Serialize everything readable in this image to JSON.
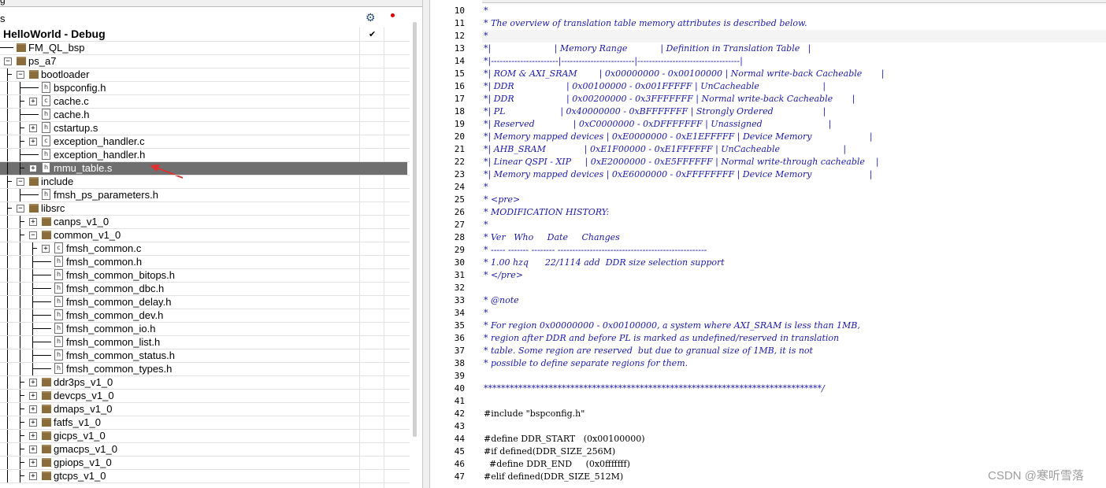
{
  "left_panel": {
    "top_fragment": "g",
    "header_title": "s",
    "tree": [
      {
        "label": "HelloWorld - Debug",
        "type": "project",
        "level": 0,
        "expander": "none"
      },
      {
        "label": "FM_QL_bsp",
        "type": "folder",
        "level": 1,
        "expander": "none"
      },
      {
        "label": "ps_a7",
        "type": "folder",
        "level": 1,
        "expander": "minus"
      },
      {
        "label": "bootloader",
        "type": "folder",
        "level": 2,
        "expander": "minus"
      },
      {
        "label": "bspconfig.h",
        "type": "file-h",
        "level": 3,
        "expander": "none"
      },
      {
        "label": "cache.c",
        "type": "file-c",
        "level": 3,
        "expander": "plus"
      },
      {
        "label": "cache.h",
        "type": "file-h",
        "level": 3,
        "expander": "none"
      },
      {
        "label": "cstartup.s",
        "type": "file-h",
        "level": 3,
        "expander": "plus"
      },
      {
        "label": "exception_handler.c",
        "type": "file-c",
        "level": 3,
        "expander": "plus"
      },
      {
        "label": "exception_handler.h",
        "type": "file-h",
        "level": 3,
        "expander": "none"
      },
      {
        "label": "mmu_table.s",
        "type": "file-h",
        "level": 3,
        "expander": "plus",
        "selected": true
      },
      {
        "label": "include",
        "type": "folder",
        "level": 2,
        "expander": "minus"
      },
      {
        "label": "fmsh_ps_parameters.h",
        "type": "file-h",
        "level": 3,
        "expander": "none"
      },
      {
        "label": "libsrc",
        "type": "folder",
        "level": 2,
        "expander": "minus"
      },
      {
        "label": "canps_v1_0",
        "type": "folder",
        "level": 3,
        "expander": "plus"
      },
      {
        "label": "common_v1_0",
        "type": "folder",
        "level": 3,
        "expander": "minus"
      },
      {
        "label": "fmsh_common.c",
        "type": "file-c",
        "level": 4,
        "expander": "plus"
      },
      {
        "label": "fmsh_common.h",
        "type": "file-h",
        "level": 4,
        "expander": "none"
      },
      {
        "label": "fmsh_common_bitops.h",
        "type": "file-h",
        "level": 4,
        "expander": "none"
      },
      {
        "label": "fmsh_common_dbc.h",
        "type": "file-h",
        "level": 4,
        "expander": "none"
      },
      {
        "label": "fmsh_common_delay.h",
        "type": "file-h",
        "level": 4,
        "expander": "none"
      },
      {
        "label": "fmsh_common_dev.h",
        "type": "file-h",
        "level": 4,
        "expander": "none"
      },
      {
        "label": "fmsh_common_io.h",
        "type": "file-h",
        "level": 4,
        "expander": "none"
      },
      {
        "label": "fmsh_common_list.h",
        "type": "file-h",
        "level": 4,
        "expander": "none"
      },
      {
        "label": "fmsh_common_status.h",
        "type": "file-h",
        "level": 4,
        "expander": "none"
      },
      {
        "label": "fmsh_common_types.h",
        "type": "file-h",
        "level": 4,
        "expander": "none"
      },
      {
        "label": "ddr3ps_v1_0",
        "type": "folder",
        "level": 3,
        "expander": "plus"
      },
      {
        "label": "devcps_v1_0",
        "type": "folder",
        "level": 3,
        "expander": "plus"
      },
      {
        "label": "dmaps_v1_0",
        "type": "folder",
        "level": 3,
        "expander": "plus"
      },
      {
        "label": "fatfs_v1_0",
        "type": "folder",
        "level": 3,
        "expander": "plus"
      },
      {
        "label": "gicps_v1_0",
        "type": "folder",
        "level": 3,
        "expander": "plus"
      },
      {
        "label": "gmacps_v1_0",
        "type": "folder",
        "level": 3,
        "expander": "plus"
      },
      {
        "label": "gpiops_v1_0",
        "type": "folder",
        "level": 3,
        "expander": "plus"
      },
      {
        "label": "gtcps_v1_0",
        "type": "folder",
        "level": 3,
        "expander": "plus"
      }
    ]
  },
  "editor": {
    "lines": [
      {
        "n": "10",
        "t": "*",
        "k": "c"
      },
      {
        "n": "11",
        "t": "* The overview of translation table memory attributes is described below.",
        "k": "c"
      },
      {
        "n": "12",
        "t": "*",
        "k": "c"
      },
      {
        "n": "13",
        "t": "*|                       | Memory Range            | Definition in Translation Table   |",
        "k": "c"
      },
      {
        "n": "14",
        "t": "*|-----------------------|-------------------------|-----------------------------------|",
        "k": "c"
      },
      {
        "n": "15",
        "t": "*| ROM & AXI_SRAM        | 0x00000000 - 0x00100000 | Normal write-back Cacheable       |",
        "k": "c"
      },
      {
        "n": "16",
        "t": "*| DDR                   | 0x00100000 - 0x001FFFFF | UnCacheable                       |",
        "k": "c"
      },
      {
        "n": "17",
        "t": "*| DDR                   | 0x00200000 - 0x3FFFFFFF | Normal write-back Cacheable       |",
        "k": "c"
      },
      {
        "n": "18",
        "t": "*| PL                    | 0x40000000 - 0xBFFFFFFF | Strongly Ordered                  |",
        "k": "c"
      },
      {
        "n": "19",
        "t": "*| Reserved              | 0xC0000000 - 0xDFFFFFFF | Unassigned                        |",
        "k": "c"
      },
      {
        "n": "20",
        "t": "*| Memory mapped devices | 0xE0000000 - 0xE1EFFFFF | Device Memory                     |",
        "k": "c"
      },
      {
        "n": "21",
        "t": "*| AHB_SRAM              | 0xE1F00000 - 0xE1FFFFFF | UnCacheable                       |",
        "k": "c"
      },
      {
        "n": "22",
        "t": "*| Linear QSPI - XIP     | 0xE2000000 - 0xE5FFFFFF | Normal write-through cacheable    |",
        "k": "c"
      },
      {
        "n": "23",
        "t": "*| Memory mapped devices | 0xE6000000 - 0xFFFFFFFF | Device Memory                     |",
        "k": "c"
      },
      {
        "n": "24",
        "t": "*",
        "k": "c"
      },
      {
        "n": "25",
        "t": "* <pre>",
        "k": "c"
      },
      {
        "n": "26",
        "t": "* MODIFICATION HISTORY:",
        "k": "c"
      },
      {
        "n": "27",
        "t": "*",
        "k": "c"
      },
      {
        "n": "28",
        "t": "* Ver   Who     Date     Changes",
        "k": "c"
      },
      {
        "n": "29",
        "t": "* ----- ------- -------- ---------------------------------------------------",
        "k": "c"
      },
      {
        "n": "30",
        "t": "* 1.00 hzq      22/1114 add  DDR size selection support",
        "k": "c"
      },
      {
        "n": "31",
        "t": "* </pre>",
        "k": "c"
      },
      {
        "n": "32",
        "t": "",
        "k": "c"
      },
      {
        "n": "33",
        "t": "* @note",
        "k": "c"
      },
      {
        "n": "34",
        "t": "*",
        "k": "c"
      },
      {
        "n": "35",
        "t": "* For region 0x00000000 - 0x00100000, a system where AXI_SRAM is less than 1MB,",
        "k": "c"
      },
      {
        "n": "36",
        "t": "* region after DDR and before PL is marked as undefined/reserved in translation",
        "k": "c"
      },
      {
        "n": "37",
        "t": "* table. Some region are reserved  but due to granual size of 1MB, it is not",
        "k": "c"
      },
      {
        "n": "38",
        "t": "* possible to define separate regions for them.",
        "k": "c"
      },
      {
        "n": "39",
        "t": "",
        "k": "c"
      },
      {
        "n": "40",
        "t": "******************************************************************************/",
        "k": "c"
      },
      {
        "n": "41",
        "t": "",
        "k": "k"
      },
      {
        "n": "42",
        "t": "#include \"bspconfig.h\"",
        "k": "k"
      },
      {
        "n": "43",
        "t": "",
        "k": "k"
      },
      {
        "n": "44",
        "t": "#define DDR_START   (0x00100000)",
        "k": "k"
      },
      {
        "n": "45",
        "t": "#if defined(DDR_SIZE_256M)",
        "k": "k"
      },
      {
        "n": "46",
        "t": "  #define DDR_END     (0x0fffffff)",
        "k": "k"
      },
      {
        "n": "47",
        "t": "#elif defined(DDR_SIZE_512M)",
        "k": "k"
      }
    ]
  },
  "watermark": "CSDN @寒听雪落",
  "colors": {
    "comment": "#1a1aa6",
    "selection": "#6f6f6f",
    "folder": "#8a6d3b",
    "gear": "#2a4d7a",
    "dot": "#e00000"
  },
  "icons": {
    "gear": "gear-icon",
    "check": "check-icon",
    "record": "record-dot-icon",
    "arrow": "annotation-arrow-icon"
  }
}
